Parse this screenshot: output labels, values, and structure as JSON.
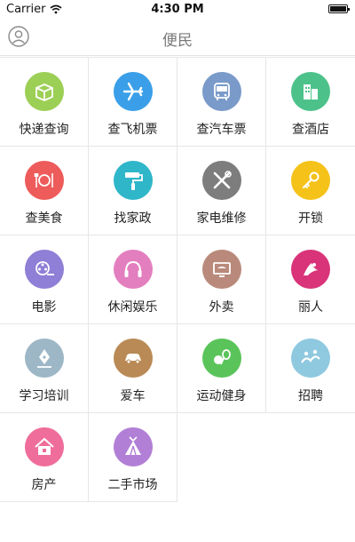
{
  "status": {
    "carrier": "Carrier",
    "time": "4:30 PM"
  },
  "header": {
    "title": "便民"
  },
  "services": [
    {
      "label": "快递查询",
      "color": "#9ccf55",
      "icon": "package-icon"
    },
    {
      "label": "查飞机票",
      "color": "#3a9fe8",
      "icon": "airplane-icon"
    },
    {
      "label": "查汽车票",
      "color": "#7a9ac9",
      "icon": "bus-icon"
    },
    {
      "label": "查酒店",
      "color": "#4cc28a",
      "icon": "hotel-icon"
    },
    {
      "label": "查美食",
      "color": "#ee5b5b",
      "icon": "dining-icon"
    },
    {
      "label": "找家政",
      "color": "#2fb6c9",
      "icon": "paint-roller-icon"
    },
    {
      "label": "家电维修",
      "color": "#7d7d7d",
      "icon": "tools-icon"
    },
    {
      "label": "开锁",
      "color": "#f5c21a",
      "icon": "key-icon"
    },
    {
      "label": "电影",
      "color": "#8f7fd6",
      "icon": "film-reel-icon"
    },
    {
      "label": "休闲娱乐",
      "color": "#e37fbf",
      "icon": "headphones-icon"
    },
    {
      "label": "外卖",
      "color": "#b98a7b",
      "icon": "food-delivery-icon"
    },
    {
      "label": "丽人",
      "color": "#d9347a",
      "icon": "beauty-icon"
    },
    {
      "label": "学习培训",
      "color": "#9db7c6",
      "icon": "pen-nib-icon"
    },
    {
      "label": "爱车",
      "color": "#b98a55",
      "icon": "car-icon"
    },
    {
      "label": "运动健身",
      "color": "#5ac45a",
      "icon": "sports-icon"
    },
    {
      "label": "招聘",
      "color": "#8ec9df",
      "icon": "recruit-icon"
    },
    {
      "label": "房产",
      "color": "#ef6d9a",
      "icon": "house-icon"
    },
    {
      "label": "二手市场",
      "color": "#b27fd6",
      "icon": "tent-icon"
    }
  ]
}
